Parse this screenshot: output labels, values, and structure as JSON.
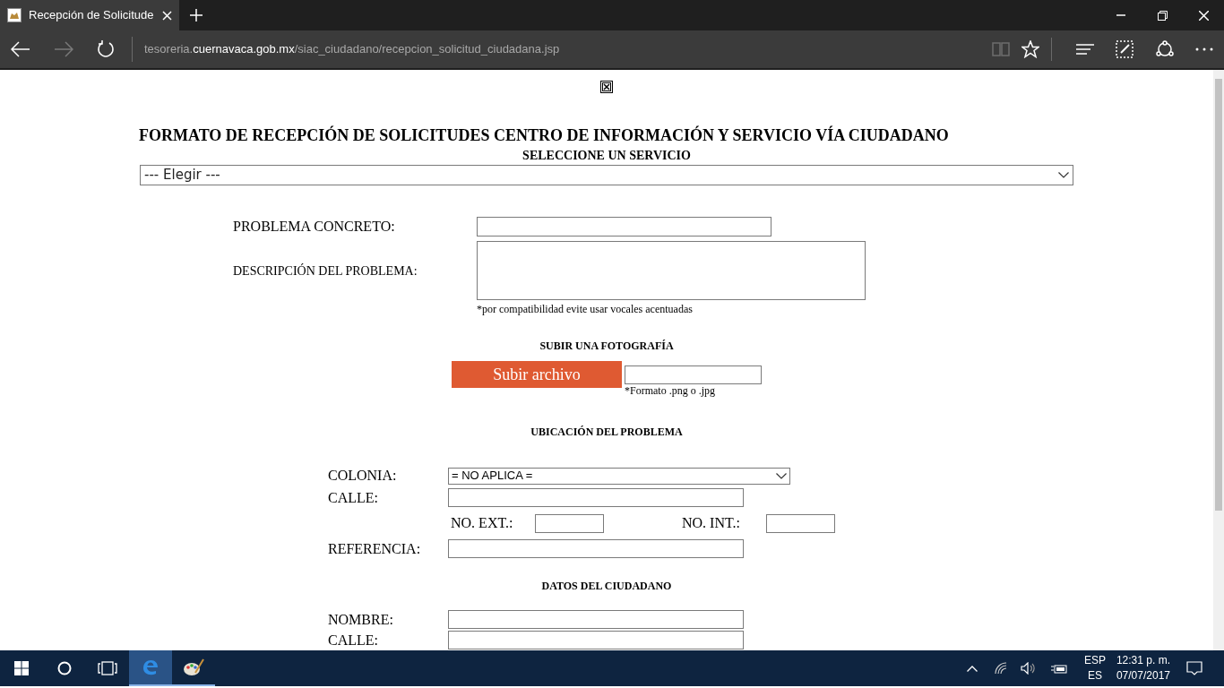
{
  "browser": {
    "tab_title": "Recepción de Solicitude",
    "url": {
      "prefix": "tesoreria.",
      "domain": "cuernavaca.gob.mx",
      "path": "/siac_ciudadano/recepcion_solicitud_ciudadana.jsp"
    }
  },
  "page": {
    "title": "FORMATO DE RECEPCIÓN DE SOLICITUDES CENTRO DE INFORMACIÓN Y SERVICIO VÍA CIUDADANO",
    "service_heading": "SELECCIONE UN SERVICIO",
    "service_select": {
      "value": "--- Elegir ---"
    },
    "problem_fields": [
      {
        "label": "PROBLEMA CONCRETO:",
        "kind": "input"
      },
      {
        "label": "DESCRIPCIÓN DEL PROBLEMA:",
        "kind": "textarea"
      }
    ],
    "accent_note": "*por compatibilidad evite usar vocales acentuadas",
    "photo": {
      "heading": "SUBIR UNA FOTOGRAFÍA",
      "button": "Subir archivo",
      "note": "*Formato .png o .jpg"
    },
    "location": {
      "heading": "UBICACIÓN DEL PROBLEMA",
      "colonia_label": "COLONIA:",
      "colonia_value": "= NO APLICA =",
      "calle_label": "CALLE:",
      "ext_label": "NO. EXT.:",
      "int_label": "NO. INT.:",
      "referencia_label": "REFERENCIA:"
    },
    "citizen": {
      "heading": "DATOS DEL CIUDADANO",
      "fields": [
        {
          "label": "NOMBRE:"
        },
        {
          "label": "CALLE:"
        }
      ]
    }
  },
  "taskbar": {
    "language": "ESP",
    "layout": "ES",
    "time": "12:31 p. m.",
    "date": "07/07/2017"
  }
}
